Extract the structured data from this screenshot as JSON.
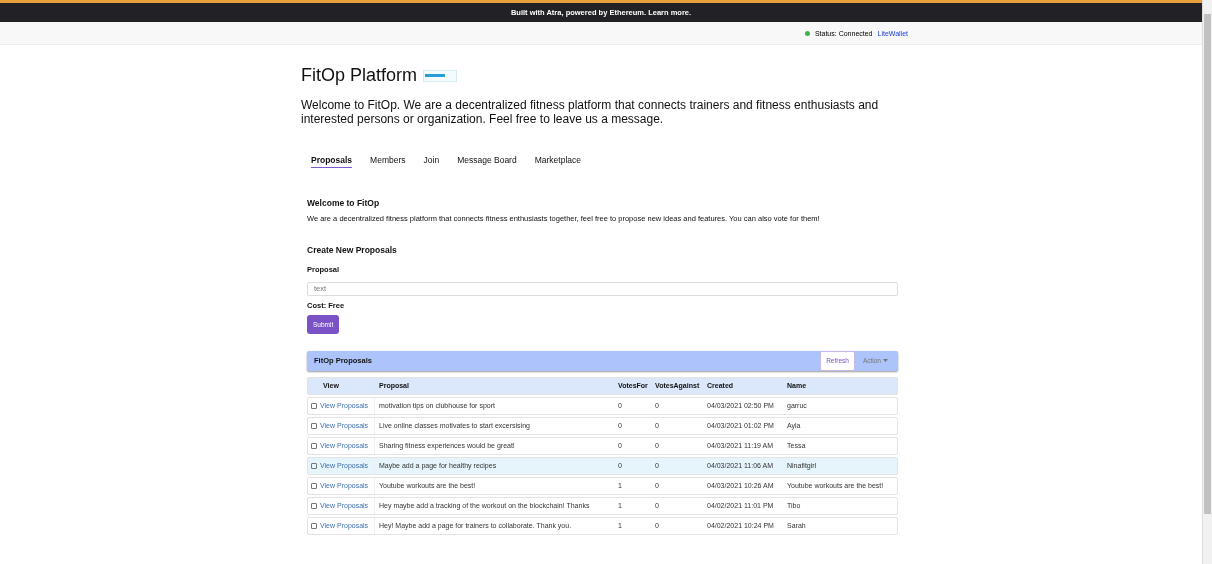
{
  "banner": {
    "text": "Built with Atra, powered by Ethereum. Learn more."
  },
  "status_bar": {
    "status": "Status: Connected",
    "connected": true,
    "wallet_link": "LiteWallet"
  },
  "header": {
    "title": "FitOp Platform",
    "intro": "Welcome to FitOp. We are a decentralized fitness platform that connects trainers and fitness enthusiasts and interested persons or organization. Feel free to leave us a message."
  },
  "tabs": [
    {
      "label": "Proposals",
      "selected": true
    },
    {
      "label": "Members",
      "selected": false
    },
    {
      "label": "Join",
      "selected": false
    },
    {
      "label": "Message Board",
      "selected": false
    },
    {
      "label": "Marketplace",
      "selected": false
    }
  ],
  "welcome": {
    "heading": "Welcome to FitOp",
    "text": "We are a decentralized fitness platform that connects fitness enthusiasts together, feel free to propose new ideas and features. You can also vote for them!"
  },
  "form": {
    "heading": "Create New Proposals",
    "field_label": "Proposal",
    "placeholder": "text",
    "cost": "Cost: Free",
    "submit": "Submit"
  },
  "proposals": {
    "title": "FitOp Proposals",
    "refresh": "Refresh",
    "action": "Action",
    "columns": [
      "View",
      "Proposal",
      "VotesFor",
      "VotesAgainst",
      "Created",
      "Name"
    ],
    "rows": [
      {
        "checked": false,
        "highlighted": false,
        "link": "View Proposals",
        "proposal": "motivation tips on clubhouse for sport",
        "votes_for": "0",
        "votes_against": "0",
        "created": "04/03/2021 02:50 PM",
        "name": "garruc"
      },
      {
        "checked": false,
        "highlighted": false,
        "link": "View Proposals",
        "proposal": "Live online classes motivates to start excersising",
        "votes_for": "0",
        "votes_against": "0",
        "created": "04/03/2021 01:02 PM",
        "name": "Ayla"
      },
      {
        "checked": false,
        "highlighted": false,
        "link": "View Proposals",
        "proposal": "Sharing fitness experiences would be great!",
        "votes_for": "0",
        "votes_against": "0",
        "created": "04/03/2021 11:19 AM",
        "name": "Tessa"
      },
      {
        "checked": false,
        "highlighted": true,
        "link": "View Proposals",
        "proposal": "Maybe add a page for healthy recipes",
        "votes_for": "0",
        "votes_against": "0",
        "created": "04/03/2021 11:06 AM",
        "name": "Ninafitgirl"
      },
      {
        "checked": false,
        "highlighted": false,
        "link": "View Proposals",
        "proposal": "Youtube workouts are the best!",
        "votes_for": "1",
        "votes_against": "0",
        "created": "04/03/2021 10:26 AM",
        "name": "Youtube workouts are the best!"
      },
      {
        "checked": false,
        "highlighted": false,
        "link": "View Proposals",
        "proposal": "Hey maybe add a tracking of the workout on the blockchain! Thanks",
        "votes_for": "1",
        "votes_against": "0",
        "created": "04/02/2021 11:01 PM",
        "name": "Tibo"
      },
      {
        "checked": false,
        "highlighted": false,
        "link": "View Proposals",
        "proposal": "Hey! Maybe add a page for trainers to collaborate. Thank you.",
        "votes_for": "1",
        "votes_against": "0",
        "created": "04/02/2021 10:24 PM",
        "name": "Sarah"
      }
    ]
  }
}
